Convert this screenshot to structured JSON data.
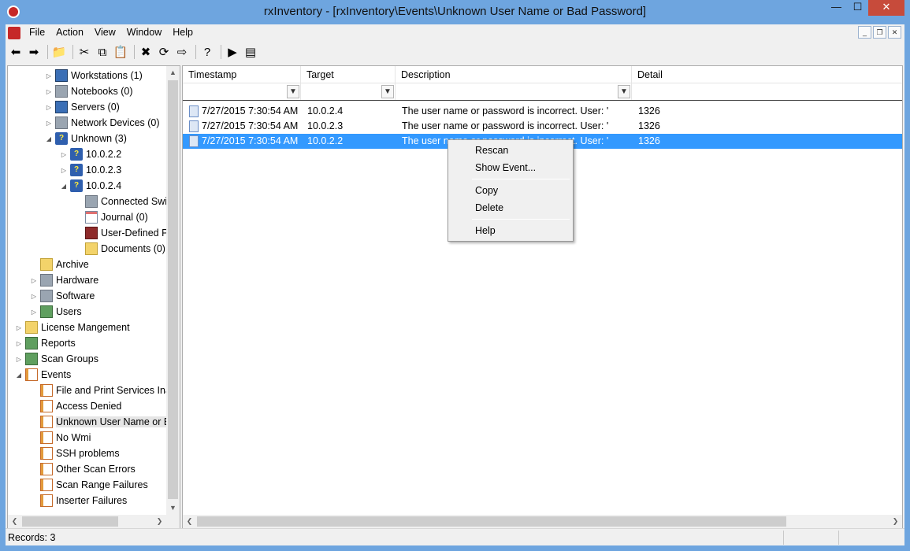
{
  "window": {
    "title": "rxInventory - [rxInventory\\Events\\Unknown User Name or Bad Password]",
    "controls": {
      "minimize": "—",
      "maximize": "☐",
      "close": "✕"
    }
  },
  "menubar": {
    "items": [
      "File",
      "Action",
      "View",
      "Window",
      "Help"
    ],
    "mdi_controls": [
      "_",
      "❐",
      "✕"
    ]
  },
  "toolbar": {
    "buttons": [
      {
        "name": "back-icon",
        "glyph": "⬅"
      },
      {
        "name": "forward-icon",
        "glyph": "➡"
      },
      {
        "name": "up-folder-icon",
        "glyph": "📁"
      },
      {
        "name": "cut-icon",
        "glyph": "✂"
      },
      {
        "name": "copy-icon",
        "glyph": "⧉"
      },
      {
        "name": "paste-icon",
        "glyph": "📋"
      },
      {
        "name": "delete-icon",
        "glyph": "✖"
      },
      {
        "name": "refresh-icon",
        "glyph": "⟳"
      },
      {
        "name": "export-icon",
        "glyph": "⇨"
      },
      {
        "name": "help-icon",
        "glyph": "?"
      },
      {
        "name": "run-icon",
        "glyph": "▶"
      },
      {
        "name": "properties-icon",
        "glyph": "▤"
      }
    ]
  },
  "tree": {
    "items": [
      {
        "label": "Workstations (1)",
        "level": 2,
        "expander": "▷",
        "icon": "computer"
      },
      {
        "label": "Notebooks (0)",
        "level": 2,
        "expander": "▷",
        "icon": "gray"
      },
      {
        "label": "Servers (0)",
        "level": 2,
        "expander": "▷",
        "icon": "computer"
      },
      {
        "label": "Network Devices (0)",
        "level": 2,
        "expander": "▷",
        "icon": "gray"
      },
      {
        "label": "Unknown (3)",
        "level": 2,
        "expander": "◢",
        "icon": "unknown"
      },
      {
        "label": "10.0.2.2",
        "level": 3,
        "expander": "▷",
        "icon": "unknown"
      },
      {
        "label": "10.0.2.3",
        "level": 3,
        "expander": "▷",
        "icon": "unknown"
      },
      {
        "label": "10.0.2.4",
        "level": 3,
        "expander": "◢",
        "icon": "unknown"
      },
      {
        "label": "Connected Swi",
        "level": 4,
        "expander": "",
        "icon": "gray"
      },
      {
        "label": "Journal (0)",
        "level": 4,
        "expander": "",
        "icon": "doc"
      },
      {
        "label": "User-Defined P",
        "level": 4,
        "expander": "",
        "icon": "red"
      },
      {
        "label": "Documents (0)",
        "level": 4,
        "expander": "",
        "icon": "folder"
      },
      {
        "label": "Archive",
        "level": 1,
        "expander": "",
        "icon": "folder"
      },
      {
        "label": "Hardware",
        "level": 1,
        "expander": "▷",
        "icon": "gray"
      },
      {
        "label": "Software",
        "level": 1,
        "expander": "▷",
        "icon": "gray"
      },
      {
        "label": "Users",
        "level": 1,
        "expander": "▷",
        "icon": "green"
      },
      {
        "label": "License Mangement",
        "level": 0,
        "expander": "▷",
        "icon": "folder"
      },
      {
        "label": "Reports",
        "level": 0,
        "expander": "▷",
        "icon": "green"
      },
      {
        "label": "Scan Groups",
        "level": 0,
        "expander": "▷",
        "icon": "green"
      },
      {
        "label": "Events",
        "level": 0,
        "expander": "◢",
        "icon": "events"
      },
      {
        "label": "File and Print Services Inac",
        "level": 1,
        "expander": "",
        "icon": "events"
      },
      {
        "label": "Access Denied",
        "level": 1,
        "expander": "",
        "icon": "events"
      },
      {
        "label": "Unknown User Name or B",
        "level": 1,
        "expander": "",
        "icon": "events",
        "selected": true
      },
      {
        "label": "No Wmi",
        "level": 1,
        "expander": "",
        "icon": "events"
      },
      {
        "label": "SSH problems",
        "level": 1,
        "expander": "",
        "icon": "events"
      },
      {
        "label": "Other Scan Errors",
        "level": 1,
        "expander": "",
        "icon": "events"
      },
      {
        "label": "Scan Range Failures",
        "level": 1,
        "expander": "",
        "icon": "events"
      },
      {
        "label": "Inserter Failures",
        "level": 1,
        "expander": "",
        "icon": "events"
      }
    ]
  },
  "grid": {
    "columns": [
      {
        "label": "Timestamp"
      },
      {
        "label": "Target"
      },
      {
        "label": "Description"
      },
      {
        "label": "Detail"
      }
    ],
    "rows": [
      {
        "timestamp": "7/27/2015 7:30:54 AM",
        "target": "10.0.2.4",
        "description": "The user name or password is incorrect. User: ''",
        "detail": "1326",
        "selected": false
      },
      {
        "timestamp": "7/27/2015 7:30:54 AM",
        "target": "10.0.2.3",
        "description": "The user name or password is incorrect. User: ''",
        "detail": "1326",
        "selected": false
      },
      {
        "timestamp": "7/27/2015 7:30:54 AM",
        "target": "10.0.2.2",
        "description": "The user name or password is incorrect. User: ''",
        "detail": "1326",
        "selected": true
      }
    ],
    "filter_glyph": "▼"
  },
  "context_menu": {
    "items": [
      "Rescan",
      "Show Event...",
      "Copy",
      "Delete",
      "Help"
    ]
  },
  "statusbar": {
    "text": "Records: 3"
  },
  "scroll_glyphs": {
    "up": "▲",
    "down": "▼",
    "left": "❮",
    "right": "❯"
  },
  "colors": {
    "title_bar": "#6ea5df",
    "selection": "#3399ff",
    "close_button": "#c74b3b"
  }
}
